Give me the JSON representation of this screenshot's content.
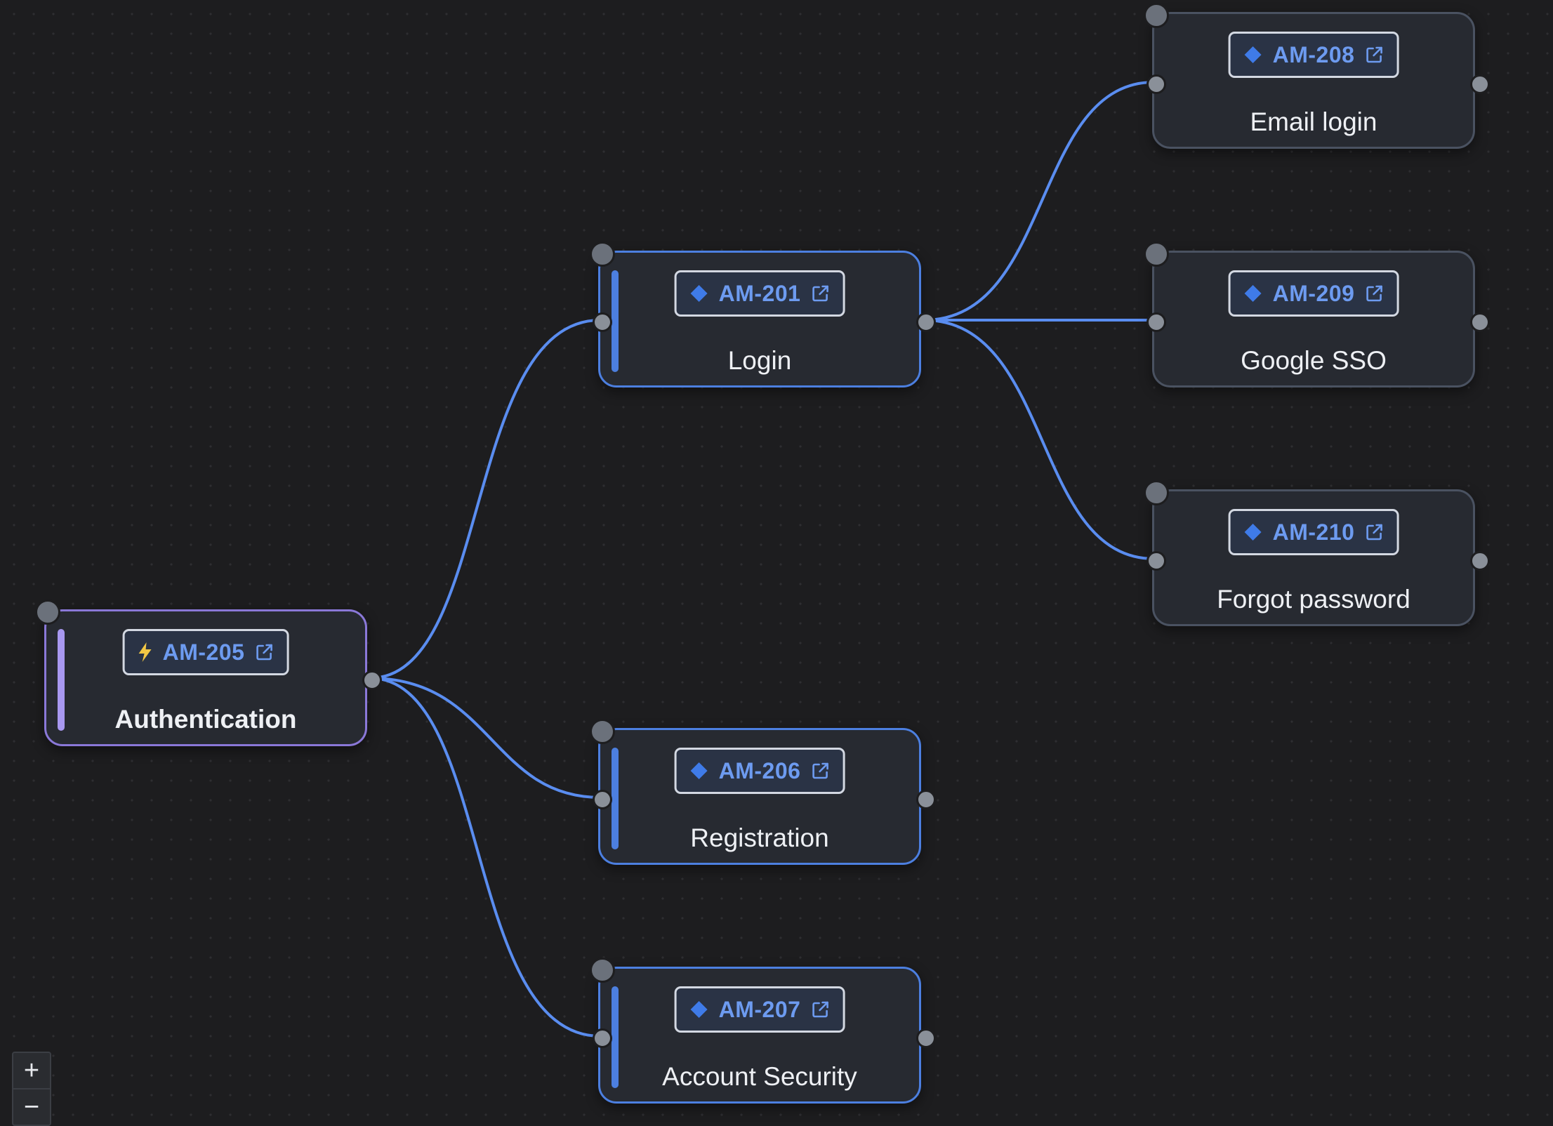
{
  "colors": {
    "edge": "#5a8df0",
    "diamond_icon": "#3f7be8",
    "bolt_icon": "#f2c744",
    "badge_key": "#6d9bf0",
    "border_blue": "#4c7fe0",
    "border_purple": "#8a78d8",
    "border_gray": "#4a5261"
  },
  "nodes": {
    "am205": {
      "key": "AM-205",
      "title": "Authentication",
      "icon": "bolt-icon"
    },
    "am201": {
      "key": "AM-201",
      "title": "Login",
      "icon": "diamond-icon"
    },
    "am206": {
      "key": "AM-206",
      "title": "Registration",
      "icon": "diamond-icon"
    },
    "am207": {
      "key": "AM-207",
      "title": "Account Security",
      "icon": "diamond-icon"
    },
    "am208": {
      "key": "AM-208",
      "title": "Email login",
      "icon": "diamond-icon"
    },
    "am209": {
      "key": "AM-209",
      "title": "Google SSO",
      "icon": "diamond-icon"
    },
    "am210": {
      "key": "AM-210",
      "title": "Forgot password",
      "icon": "diamond-icon"
    }
  },
  "edges": [
    {
      "from": "AM-205",
      "to": "AM-201"
    },
    {
      "from": "AM-205",
      "to": "AM-206"
    },
    {
      "from": "AM-205",
      "to": "AM-207"
    },
    {
      "from": "AM-201",
      "to": "AM-208"
    },
    {
      "from": "AM-201",
      "to": "AM-209"
    },
    {
      "from": "AM-201",
      "to": "AM-210"
    }
  ],
  "zoom_controls": {
    "zoom_in": "+",
    "zoom_out": "−"
  }
}
